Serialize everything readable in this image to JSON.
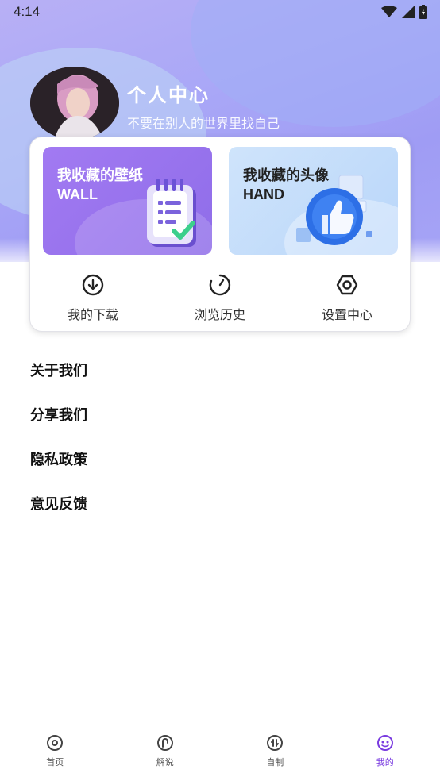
{
  "status_bar": {
    "time": "4:14"
  },
  "profile": {
    "title": "个人中心",
    "subtitle": "不要在别人的世界里找自己"
  },
  "favorites": [
    {
      "title": "我收藏的壁纸",
      "subtitle": "WALL",
      "icon": "notepad-icon"
    },
    {
      "title": "我收藏的头像",
      "subtitle": "HAND",
      "icon": "thumbs-up-icon"
    }
  ],
  "quick_actions": [
    {
      "label": "我的下载",
      "icon": "download-icon"
    },
    {
      "label": "浏览历史",
      "icon": "history-icon"
    },
    {
      "label": "设置中心",
      "icon": "settings-icon"
    }
  ],
  "menu": [
    {
      "label": "关于我们"
    },
    {
      "label": "分享我们"
    },
    {
      "label": "隐私政策"
    },
    {
      "label": "意见反馈"
    }
  ],
  "tabs": [
    {
      "label": "首页",
      "icon": "home-icon",
      "active": false
    },
    {
      "label": "解说",
      "icon": "commentary-icon",
      "active": false
    },
    {
      "label": "自制",
      "icon": "diy-icon",
      "active": false
    },
    {
      "label": "我的",
      "icon": "profile-icon",
      "active": true
    }
  ],
  "colors": {
    "accent": "#7a3ce0",
    "hero": "#a9a7f7",
    "wall_card": "#9a74ef",
    "head_card": "#c4ddfb"
  }
}
